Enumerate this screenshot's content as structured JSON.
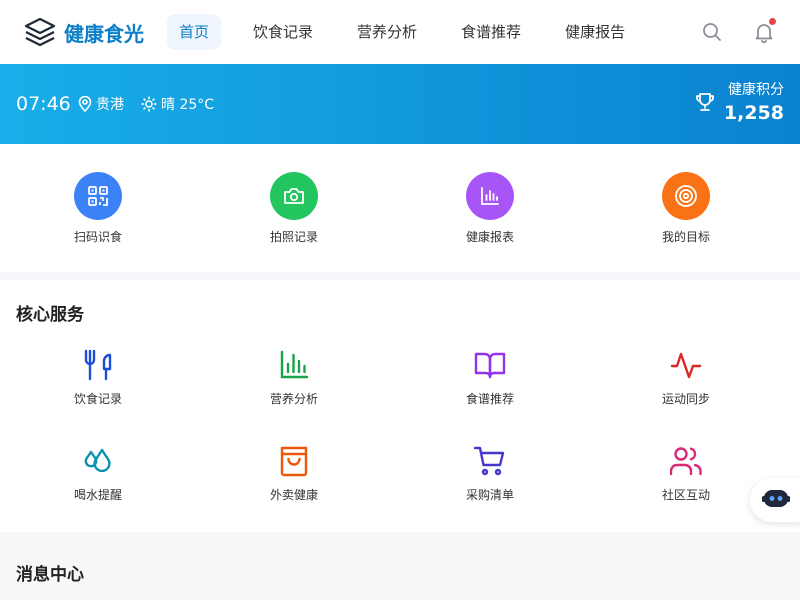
{
  "app": {
    "name": "健康食光"
  },
  "nav": {
    "items": [
      {
        "label": "首页",
        "active": true
      },
      {
        "label": "饮食记录"
      },
      {
        "label": "营养分析"
      },
      {
        "label": "食谱推荐"
      },
      {
        "label": "健康报告"
      }
    ]
  },
  "header_icons": {
    "search": "search-icon",
    "notifications": "bell-icon",
    "has_unread": true
  },
  "banner": {
    "time": "07:46",
    "location": "贵港",
    "weather": "晴 25°C",
    "points_label": "健康积分",
    "points_value": "1,258"
  },
  "quick_actions": [
    {
      "label": "扫码识食",
      "color": "#3b82f6",
      "icon": "qr-code-icon"
    },
    {
      "label": "拍照记录",
      "color": "#22c55e",
      "icon": "camera-icon"
    },
    {
      "label": "健康报表",
      "color": "#a855f7",
      "icon": "bar-chart-icon"
    },
    {
      "label": "我的目标",
      "color": "#f97316",
      "icon": "target-icon"
    }
  ],
  "core_services": {
    "title": "核心服务",
    "items": [
      {
        "label": "饮食记录",
        "color": "#1d4ed8",
        "icon": "utensils-icon"
      },
      {
        "label": "营养分析",
        "color": "#16a34a",
        "icon": "bar-chart-icon"
      },
      {
        "label": "食谱推荐",
        "color": "#9333ea",
        "icon": "book-icon"
      },
      {
        "label": "运动同步",
        "color": "#dc2626",
        "icon": "activity-icon"
      },
      {
        "label": "喝水提醒",
        "color": "#0891b2",
        "icon": "droplets-icon"
      },
      {
        "label": "外卖健康",
        "color": "#ea580c",
        "icon": "shopping-bag-icon"
      },
      {
        "label": "采购清单",
        "color": "#4338ca",
        "icon": "shopping-cart-icon"
      },
      {
        "label": "社区互动",
        "color": "#db2777",
        "icon": "users-icon"
      }
    ]
  },
  "messages": {
    "title": "消息中心"
  },
  "colors": {
    "brand": "#0b7fc7",
    "banner_start": "#19aeea",
    "banner_end": "#0a82cf"
  }
}
